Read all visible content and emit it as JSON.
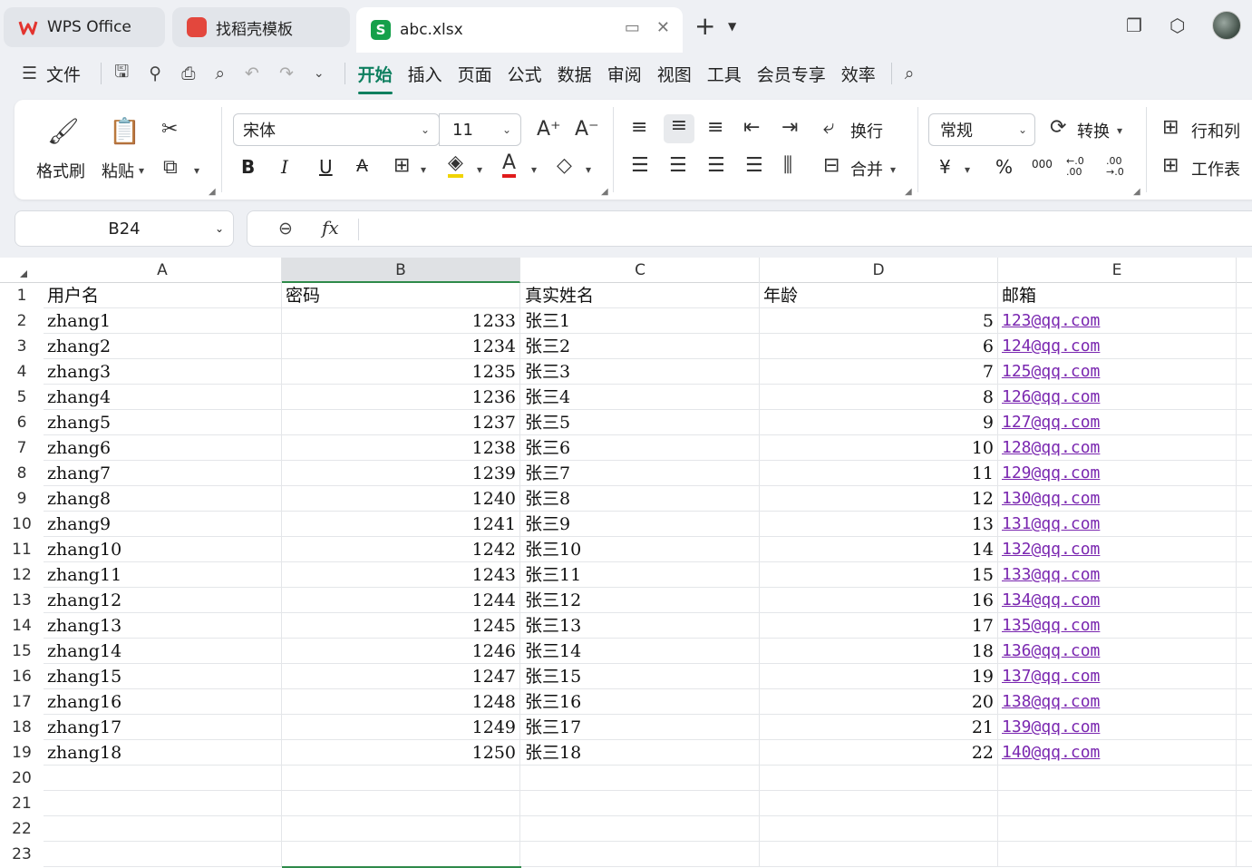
{
  "tabs": {
    "wps": "WPS Office",
    "daoke": "找稻壳模板",
    "file": "abc.xlsx",
    "file_icon_letter": "S"
  },
  "menu": {
    "file": "文件",
    "items": [
      "开始",
      "插入",
      "页面",
      "公式",
      "数据",
      "审阅",
      "视图",
      "工具",
      "会员专享",
      "效率"
    ],
    "active": "开始"
  },
  "ribbon": {
    "format_painter": "格式刷",
    "paste": "粘贴",
    "font_name": "宋体",
    "font_size": "11",
    "wrap": "换行",
    "merge": "合并",
    "number_format": "常规",
    "convert": "转换",
    "row_col": "行和列",
    "worksheet": "工作表",
    "bold": "B",
    "italic": "I",
    "underline": "U",
    "strike": "A",
    "currency": "¥",
    "percent": "%",
    "thousands": "000",
    "inc_decimal": "←.0 .00",
    "dec_decimal": ".00 →.0"
  },
  "formula_bar": {
    "cell_ref": "B24",
    "fx": "fx",
    "formula": ""
  },
  "colors": {
    "accent": "#0d7f5f",
    "link": "#7a27b0",
    "selected_col_border": "#2f8a4a"
  },
  "sheet": {
    "columns": [
      "A",
      "B",
      "C",
      "D",
      "E"
    ],
    "selected_column": "B",
    "row_numbers": [
      "1",
      "2",
      "3",
      "4",
      "5",
      "6",
      "7",
      "8",
      "9",
      "10",
      "11",
      "12",
      "13",
      "14",
      "15",
      "16",
      "17",
      "18",
      "19",
      "20",
      "21",
      "22",
      "23"
    ],
    "header": [
      "用户名",
      "密码",
      "真实姓名",
      "年龄",
      "邮箱"
    ],
    "rows": [
      [
        "zhang1",
        "1233",
        "张三1",
        "5",
        "123@qq.com"
      ],
      [
        "zhang2",
        "1234",
        "张三2",
        "6",
        "124@qq.com"
      ],
      [
        "zhang3",
        "1235",
        "张三3",
        "7",
        "125@qq.com"
      ],
      [
        "zhang4",
        "1236",
        "张三4",
        "8",
        "126@qq.com"
      ],
      [
        "zhang5",
        "1237",
        "张三5",
        "9",
        "127@qq.com"
      ],
      [
        "zhang6",
        "1238",
        "张三6",
        "10",
        "128@qq.com"
      ],
      [
        "zhang7",
        "1239",
        "张三7",
        "11",
        "129@qq.com"
      ],
      [
        "zhang8",
        "1240",
        "张三8",
        "12",
        "130@qq.com"
      ],
      [
        "zhang9",
        "1241",
        "张三9",
        "13",
        "131@qq.com"
      ],
      [
        "zhang10",
        "1242",
        "张三10",
        "14",
        "132@qq.com"
      ],
      [
        "zhang11",
        "1243",
        "张三11",
        "15",
        "133@qq.com"
      ],
      [
        "zhang12",
        "1244",
        "张三12",
        "16",
        "134@qq.com"
      ],
      [
        "zhang13",
        "1245",
        "张三13",
        "17",
        "135@qq.com"
      ],
      [
        "zhang14",
        "1246",
        "张三14",
        "18",
        "136@qq.com"
      ],
      [
        "zhang15",
        "1247",
        "张三15",
        "19",
        "137@qq.com"
      ],
      [
        "zhang16",
        "1248",
        "张三16",
        "20",
        "138@qq.com"
      ],
      [
        "zhang17",
        "1249",
        "张三17",
        "21",
        "139@qq.com"
      ],
      [
        "zhang18",
        "1250",
        "张三18",
        "22",
        "140@qq.com"
      ]
    ]
  }
}
